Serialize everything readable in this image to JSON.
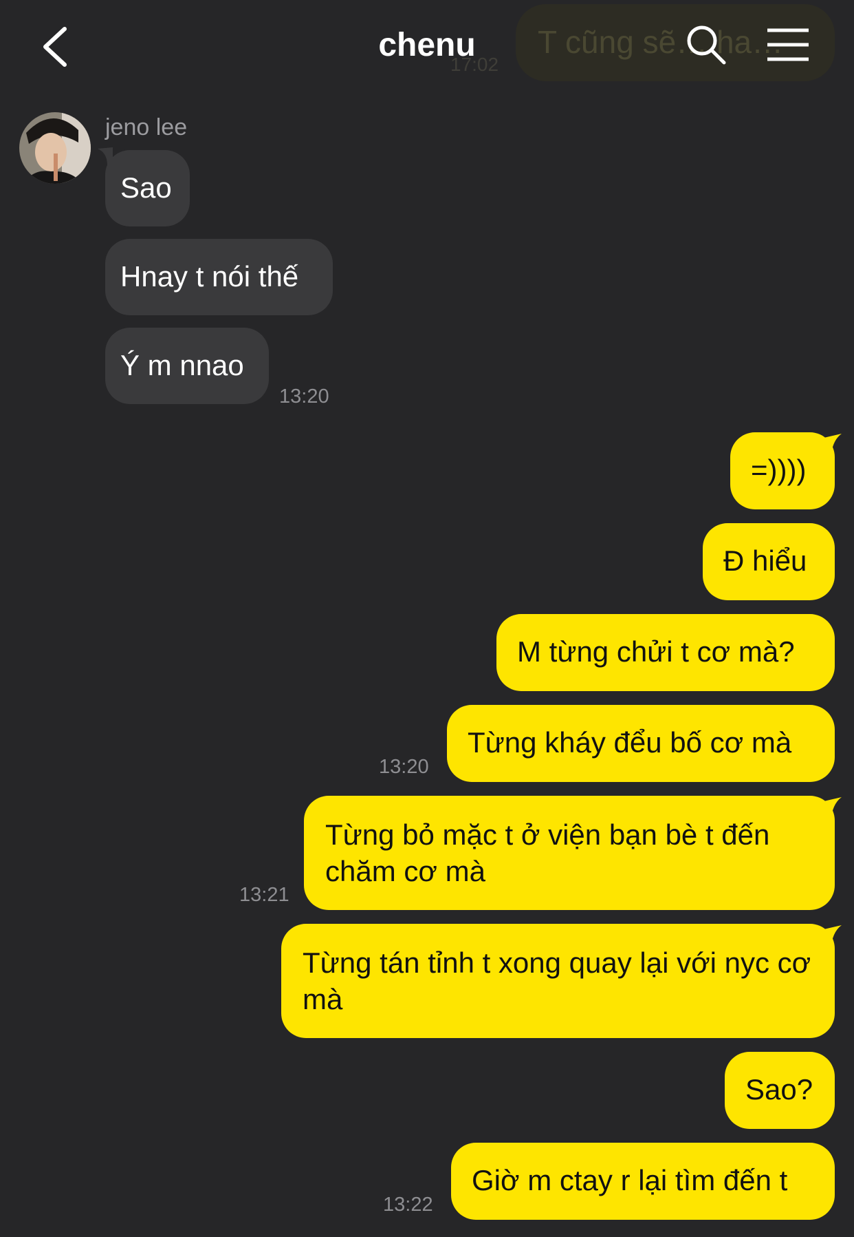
{
  "header": {
    "title": "chenu",
    "back_icon": "chevron-left-icon",
    "search_icon": "search-icon",
    "menu_icon": "hamburger-menu-icon",
    "pinned_preview_text": "T cũng sẽ… ha…",
    "pinned_preview_time": "17:02"
  },
  "contact": {
    "name": "jeno lee",
    "avatar": "avatar-photo"
  },
  "colors": {
    "background": "#262628",
    "incoming_bubble": "#3a3a3c",
    "outgoing_bubble": "#fee500",
    "timestamp": "#8e8e92"
  },
  "messages": [
    {
      "dir": "in",
      "text": "Sao"
    },
    {
      "dir": "in",
      "text": "Hnay t nói thế"
    },
    {
      "dir": "in",
      "text": "Ý m nnao",
      "time": "13:20"
    },
    {
      "dir": "out",
      "text": "=))))"
    },
    {
      "dir": "out",
      "text": "Đ hiểu"
    },
    {
      "dir": "out",
      "text": "M từng chửi t cơ mà?"
    },
    {
      "dir": "out",
      "text": "Từng kháy đểu bố cơ mà",
      "time": "13:20"
    },
    {
      "dir": "out",
      "text": "Từng bỏ mặc t ở viện bạn bè t đến chăm cơ mà",
      "time": "13:21"
    },
    {
      "dir": "out",
      "text": "Từng tán tỉnh t xong quay lại với nyc cơ mà"
    },
    {
      "dir": "out",
      "text": "Sao?"
    },
    {
      "dir": "out",
      "text": "Giờ m ctay r lại tìm đến t",
      "time": "13:22"
    }
  ]
}
